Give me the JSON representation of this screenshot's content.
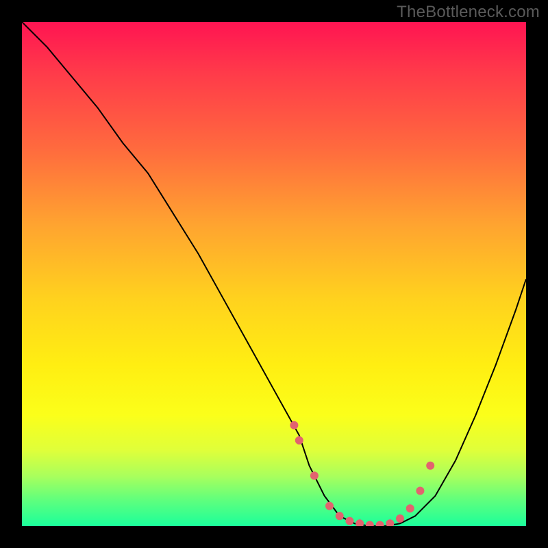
{
  "watermark": "TheBottleneck.com",
  "colors": {
    "frame_bg": "#000000",
    "gradient_top": "#ff1452",
    "gradient_bottom": "#1bff9b",
    "curve_stroke": "#000000",
    "dot_fill": "#e2636f",
    "watermark_text": "#5a5a5a"
  },
  "chart_data": {
    "type": "line",
    "title": "",
    "xlabel": "",
    "ylabel": "",
    "xlim": [
      0,
      100
    ],
    "ylim": [
      0,
      100
    ],
    "series": [
      {
        "name": "bottleneck-curve",
        "x": [
          0,
          5,
          10,
          15,
          20,
          25,
          30,
          35,
          40,
          45,
          50,
          55,
          57,
          60,
          63,
          66,
          69,
          72,
          75,
          78,
          82,
          86,
          90,
          94,
          98,
          100
        ],
        "y": [
          100,
          95,
          89,
          83,
          76,
          70,
          62,
          54,
          45,
          36,
          27,
          18,
          12,
          6,
          2,
          0.5,
          0,
          0,
          0.5,
          2,
          6,
          13,
          22,
          32,
          43,
          49
        ]
      }
    ],
    "markers": {
      "name": "highlight-points",
      "x": [
        54,
        55,
        58,
        61,
        63,
        65,
        67,
        69,
        71,
        73,
        75,
        77,
        79,
        81
      ],
      "y": [
        20,
        17,
        10,
        4,
        2,
        1,
        0.5,
        0.2,
        0.2,
        0.5,
        1.5,
        3.5,
        7,
        12
      ]
    }
  }
}
